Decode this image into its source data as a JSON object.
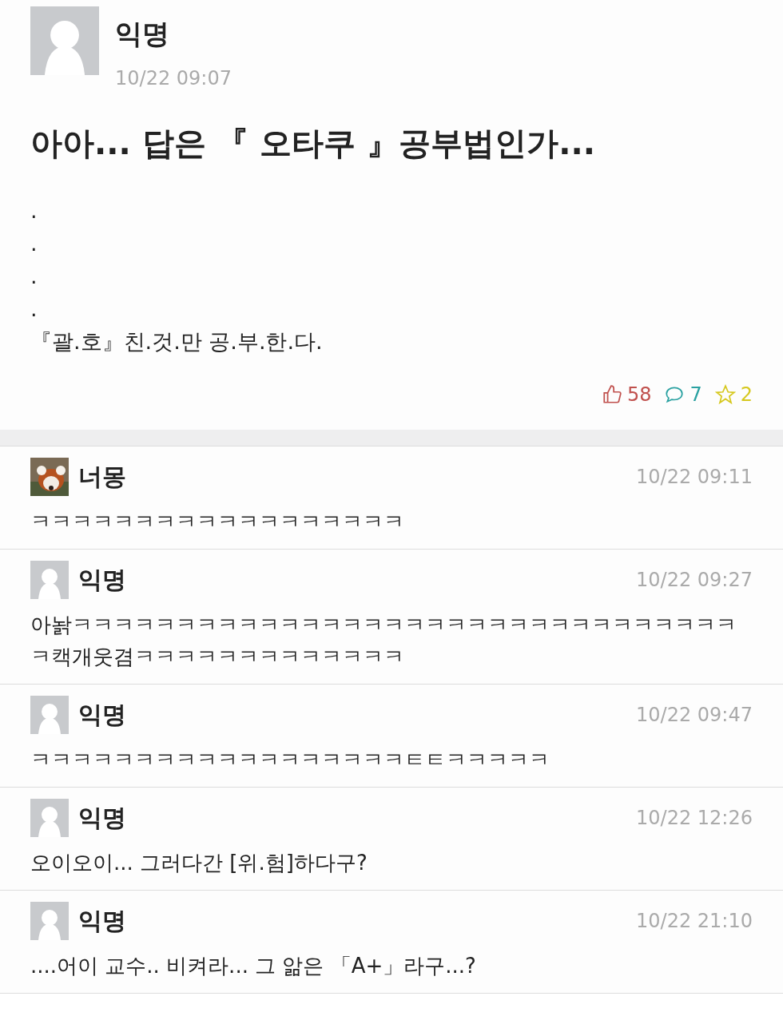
{
  "post": {
    "author": "익명",
    "time": "10/22 09:07",
    "title": "아아... 답은 『 오타쿠 』공부법인가...",
    "body_lines": [
      ".",
      ".",
      ".",
      ".",
      "『괄.호』친.것.만 공.부.한.다."
    ],
    "stats": [
      {
        "kind": "like",
        "count": "58",
        "color": "#c0504d"
      },
      {
        "kind": "comment",
        "count": "7",
        "color": "#2aa1a1"
      },
      {
        "kind": "star",
        "count": "2",
        "color": "#d6c81e"
      }
    ]
  },
  "comments": [
    {
      "kind": "picture",
      "author": "너몽",
      "time": "10/22 09:11",
      "text": "ㅋㅋㅋㅋㅋㅋㅋㅋㅋㅋㅋㅋㅋㅋㅋㅋㅋㅋ"
    },
    {
      "kind": "default",
      "author": "익명",
      "time": "10/22 09:27",
      "text": "아놝ㅋㅋㅋㅋㅋㅋㅋㅋㅋㅋㅋㅋㅋㅋㅋㅋㅋㅋㅋㅋㅋㅋㅋㅋㅋㅋㅋㅋㅋㅋㅋㅋㅋ캑개웃겸ㅋㅋㅋㅋㅋㅋㅋㅋㅋㅋㅋㅋㅋ"
    },
    {
      "kind": "default",
      "author": "익명",
      "time": "10/22 09:47",
      "text": "ㅋㅋㅋㅋㅋㅋㅋㅋㅋㅋㅋㅋㅋㅋㅋㅋㅋㅋㅌㅌㅋㅋㅋㅋㅋ"
    },
    {
      "kind": "default",
      "author": "익명",
      "time": "10/22 12:26",
      "text": "오이오이... 그러다간 [위.험]하다구?"
    },
    {
      "kind": "default",
      "author": "익명",
      "time": "10/22 21:10",
      "text": "....어이 교수.. 비켜라... 그 앎은 「A+」라구...?"
    }
  ]
}
